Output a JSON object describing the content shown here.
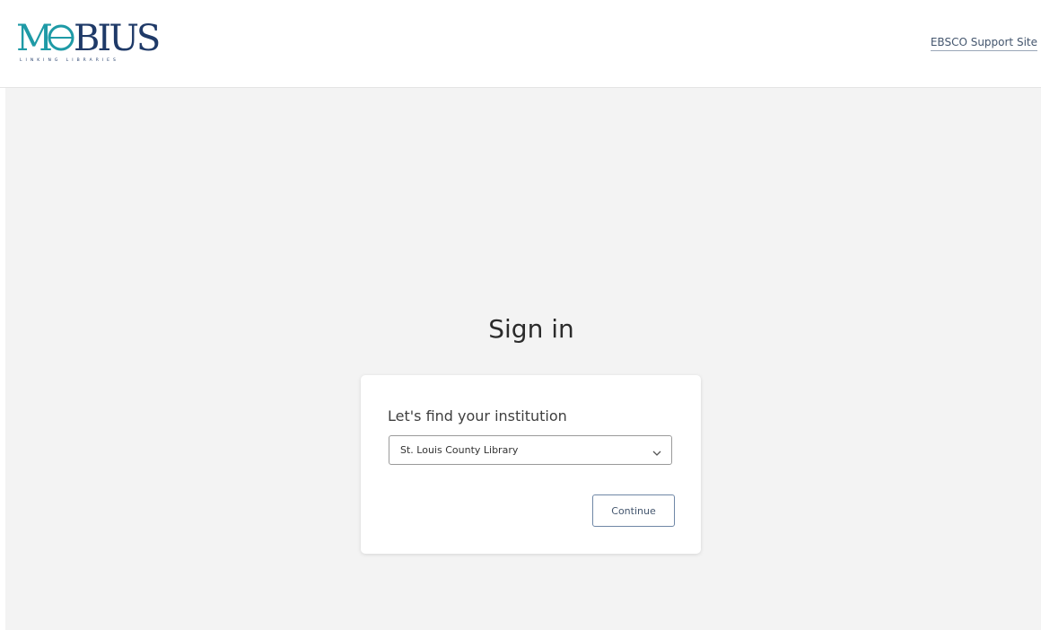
{
  "header": {
    "logo_text": "MOBIUS",
    "logo_subtext": "LINKING LIBRARIES",
    "support_link": "EBSCO Support Site"
  },
  "main": {
    "title": "Sign in",
    "card": {
      "label": "Let's find your institution",
      "select_value": "St. Louis County Library",
      "continue_label": "Continue"
    }
  },
  "colors": {
    "logo_teal": "#1e9aa6",
    "logo_navy": "#1f3a68",
    "background": "#f3f3f3",
    "button_border": "#6f87a6"
  },
  "icons": {
    "dropdown": "chevron-down-icon"
  }
}
